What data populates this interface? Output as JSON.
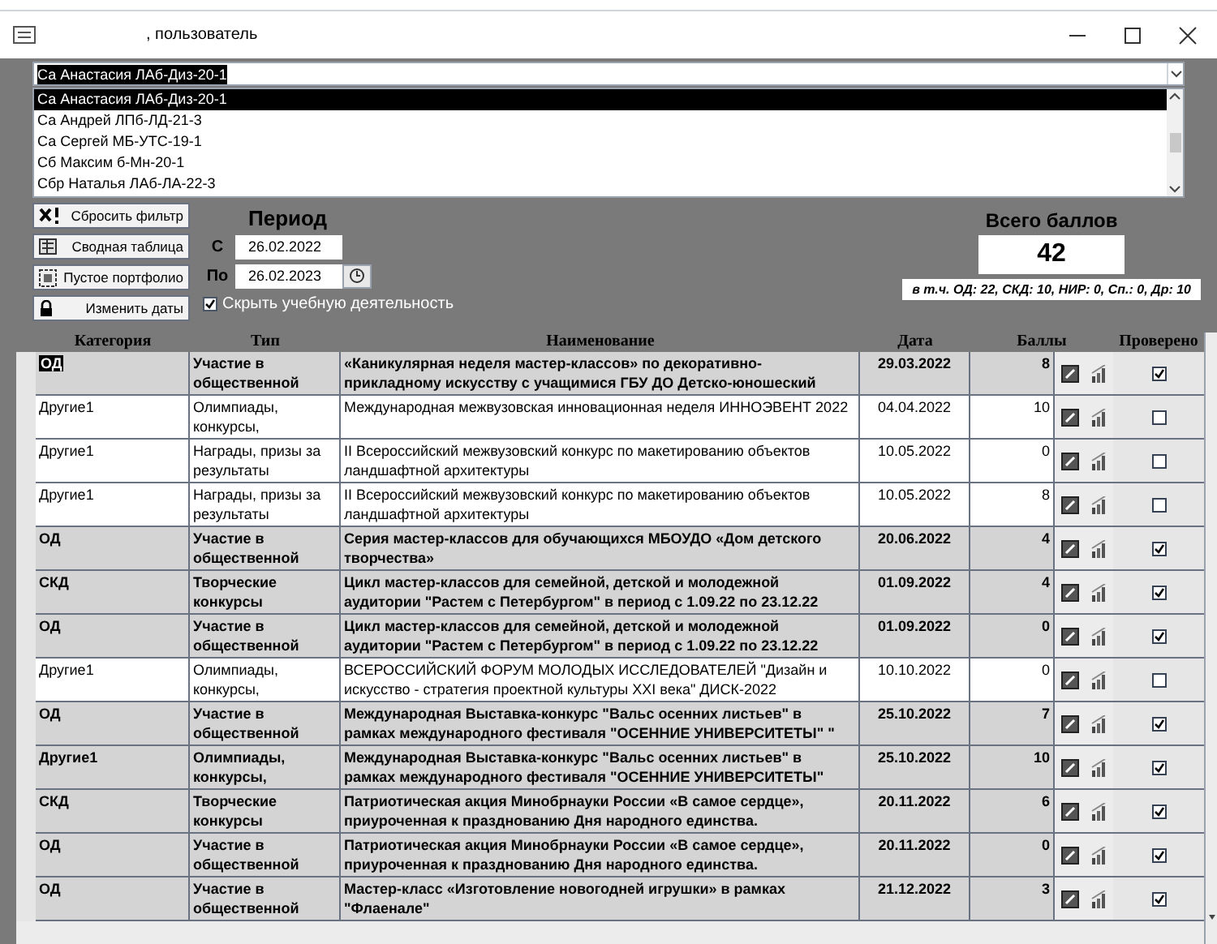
{
  "window": {
    "title": ", пользователь"
  },
  "student_combo": {
    "value": "Са Анастасия ЛАб-Диз-20-1"
  },
  "student_list": [
    {
      "text": "Са Анастасия ЛАб-Диз-20-1",
      "selected": true
    },
    {
      "text": "Са Андрей ЛПб-ЛД-21-3",
      "selected": false
    },
    {
      "text": "Са Сергей МБ-УТС-19-1",
      "selected": false
    },
    {
      "text": "Сб Максим б-Мн-20-1",
      "selected": false
    },
    {
      "text": "Сбр Наталья ЛАб-ЛА-22-3",
      "selected": false
    }
  ],
  "buttons": [
    {
      "label": "Сбросить фильтр",
      "kind": "reset"
    },
    {
      "label": "Сводная таблица",
      "kind": "table"
    },
    {
      "label": "Пустое портфолио",
      "kind": "empty"
    },
    {
      "label": "Изменить даты",
      "kind": "lock"
    }
  ],
  "period": {
    "title": "Период",
    "from_label": "С",
    "from": "26.02.2022",
    "to_label": "По",
    "to": "26.02.2023"
  },
  "hide_study": {
    "label": "Скрыть учебную деятельность",
    "checked": true
  },
  "total": {
    "title": "Всего баллов",
    "value": "42",
    "breakdown": "в т.ч. ОД: 22, СКД: 10, НИР: 0, Сп.: 0, Др: 10"
  },
  "table": {
    "columns": [
      "Категория",
      "Тип",
      "Наименование",
      "Дата",
      "Баллы",
      "Проверено"
    ],
    "rows": [
      {
        "category": "ОД",
        "type": "Участие в общественной",
        "name": "«Каникулярная неделя  мастер-классов» по декоративно-прикладному искусству с  учащимися ГБУ ДО Детско-юношеский",
        "date": "29.03.2022",
        "points": "8",
        "checked": true,
        "selected": true
      },
      {
        "category": "Другие1",
        "type": "Олимпиады, конкурсы,",
        "name": "Международная межвузовская инновационная неделя ИННОЭВЕНТ 2022",
        "date": "04.04.2022",
        "points": "10",
        "checked": false,
        "selected": false
      },
      {
        "category": "Другие1",
        "type": "Награды, призы за результаты",
        "name": "II Всероссийский межвузовский конкурс  по макетированию объектов  ландшафтной архитектуры",
        "date": "10.05.2022",
        "points": "0",
        "checked": false,
        "selected": false
      },
      {
        "category": "Другие1",
        "type": "Награды, призы за результаты",
        "name": "II Всероссийский межвузовский конкурс  по макетированию объектов  ландшафтной архитектуры",
        "date": "10.05.2022",
        "points": "8",
        "checked": false,
        "selected": false
      },
      {
        "category": "ОД",
        "type": "Участие в общественной",
        "name": " Серия мастер-классов для обучающихся МБОУДО «Дом детского творчества»",
        "date": "20.06.2022",
        "points": "4",
        "checked": true,
        "selected": false
      },
      {
        "category": "СКД",
        "type": "Творческие конкурсы",
        "name": "Цикл мастер-классов для семейной, детской и молодежной аудитории \"Растем с Петербургом\" в период с 1.09.22 по 23.12.22",
        "date": "01.09.2022",
        "points": "4",
        "checked": true,
        "selected": false
      },
      {
        "category": "ОД",
        "type": "Участие в общественной",
        "name": "Цикл мастер-классов для семейной, детской и молодежной аудитории \"Растем с Петербургом\" в период с 1.09.22 по 23.12.22",
        "date": "01.09.2022",
        "points": "0",
        "checked": true,
        "selected": false
      },
      {
        "category": "Другие1",
        "type": "Олимпиады, конкурсы,",
        "name": "ВСЕРОССИЙСКИЙ ФОРУМ МОЛОДЫХ ИССЛЕДОВАТЕЛЕЙ \"Дизайн и искусство - стратегия проектной культуры XXI века\" ДИСК-2022",
        "date": "10.10.2022",
        "points": "0",
        "checked": false,
        "selected": false
      },
      {
        "category": "ОД",
        "type": "Участие в общественной",
        "name": "Международная Выставка-конкурс \"Вальс осенних листьев\" в рамках международного фестиваля \"ОСЕННИЕ УНИВЕРСИТЕТЫ\" \"",
        "date": "25.10.2022",
        "points": "7",
        "checked": true,
        "selected": false
      },
      {
        "category": "Другие1",
        "type": "Олимпиады, конкурсы,",
        "name": "Международная Выставка-конкурс \"Вальс осенних листьев\" в рамках международного фестиваля \"ОСЕННИЕ УНИВЕРСИТЕТЫ\"",
        "date": "25.10.2022",
        "points": "10",
        "checked": true,
        "selected": false
      },
      {
        "category": "СКД",
        "type": "Творческие конкурсы",
        "name": "Патриотическая акция Минобрнауки России «В самое сердце», приуроченная к празднованию Дня народного единства.",
        "date": "20.11.2022",
        "points": "6",
        "checked": true,
        "selected": false
      },
      {
        "category": "ОД",
        "type": "Участие в общественной",
        "name": "Патриотическая акция Минобрнауки России «В самое сердце», приуроченная к празднованию Дня народного единства.",
        "date": "20.11.2022",
        "points": "0",
        "checked": true,
        "selected": false
      },
      {
        "category": "ОД",
        "type": "Участие в общественной",
        "name": "Мастер-класс «Изготовление новогодней игрушки» в рамках \"Флаенале\"",
        "date": "21.12.2022",
        "points": "3",
        "checked": true,
        "selected": false
      }
    ]
  }
}
